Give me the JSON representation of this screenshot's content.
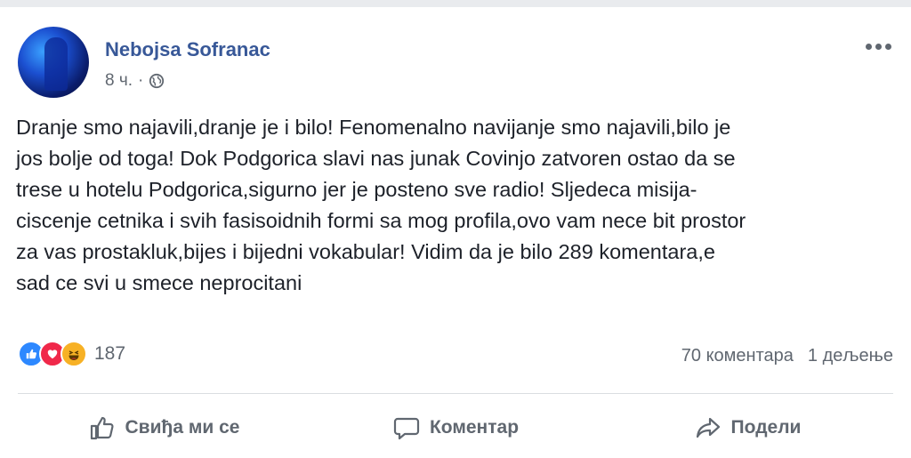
{
  "post": {
    "author": "Nebojsa Sofranac",
    "time": "8 ч.",
    "separator": "·",
    "privacy_icon": "globe-icon",
    "more_icon": "more-options-icon",
    "text": "Dranje smo najavili,dranje je i bilo! Fenomenalno navijanje smo najavili,bilo je\njos bolje od toga! Dok Podgorica slavi nas junak Covinjo zatvoren ostao da se\ntrese u hotelu Podgorica,sigurno jer je posteno sve radio! Sljedeca misija-\nciscenje cetnika i svih fasisoidnih formi sa mog profila,ovo vam nece bit prostor\nza vas prostakluk,bijes i bijedni vokabular! Vidim da je bilo 289 komentara,e\nsad ce svi u smece neprocitani"
  },
  "reactions": {
    "icons": [
      "like-icon",
      "love-icon",
      "haha-icon"
    ],
    "count": "187"
  },
  "stats": {
    "comments": "70 коментара",
    "shares": "1 дељење"
  },
  "actions": {
    "like": "Свиђа ми се",
    "comment": "Коментар",
    "share": "Подели"
  },
  "colors": {
    "author": "#385898",
    "like_blue": "#2d88ff",
    "love_red": "#f0284a",
    "haha_yellow": "#f7b125",
    "muted_text": "#606770"
  }
}
